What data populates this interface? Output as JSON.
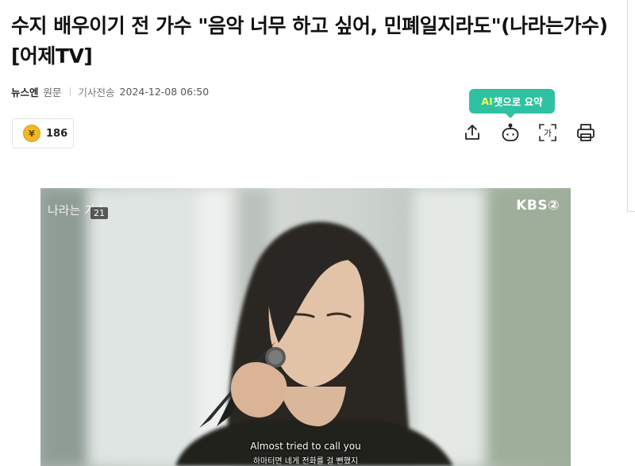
{
  "article": {
    "title": "수지 배우이기 전 가수 \"음악 너무 하고 싶어, 민폐일지라도\"(나라는가수)[어제TV]",
    "press": "뉴스엔",
    "origin_label": "원문",
    "date_label": "기사전송",
    "date": "2024-12-08 06:50"
  },
  "reactions": {
    "icon": "coin-icon",
    "coin_glyph": "¥",
    "count": "186"
  },
  "ai_tooltip": {
    "ai": "AI",
    "rest": "챗으로 요약",
    "bg": "#2fc2a2"
  },
  "tools": {
    "share": "share-icon",
    "ai_chat": "ai-chat-icon",
    "font_size": "font-size-icon",
    "font_glyph": "가",
    "print": "print-icon"
  },
  "video": {
    "program_logo": "나라는 가수",
    "episode": "21",
    "broadcaster": "KBS②",
    "subtitle_en": "Almost tried to call you",
    "subtitle_ko": "하마터면 네게 전화를 걸 뻔했지"
  }
}
